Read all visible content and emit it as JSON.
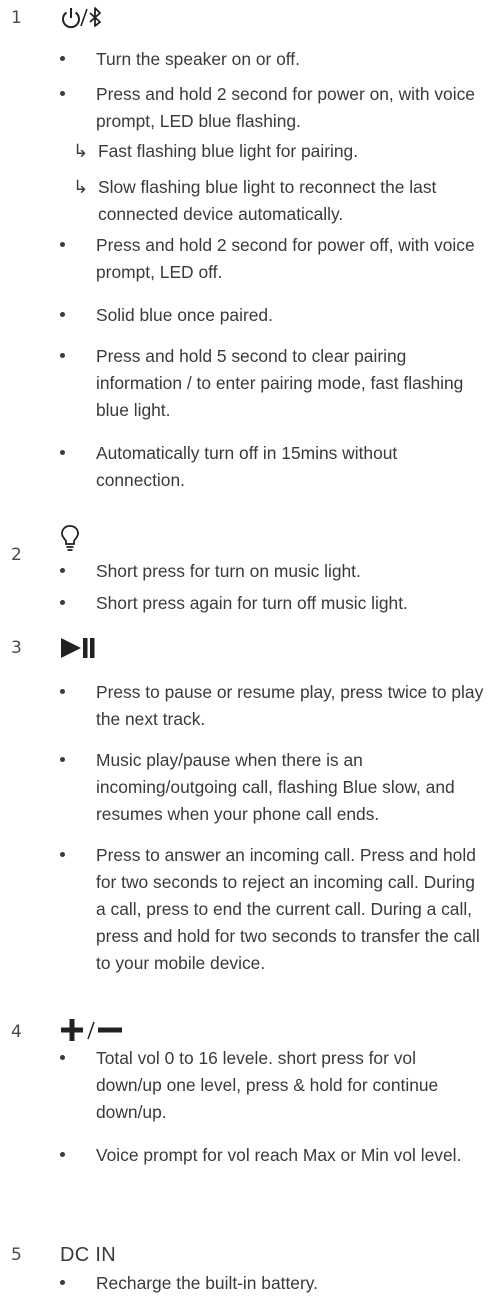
{
  "sections": [
    {
      "number": "1",
      "icon": "power-bluetooth-icon",
      "bullets": [
        "Turn the speaker on or off.",
        "Press and hold 2 second for power on, with voice prompt, LED blue flashing."
      ],
      "sub_items": [
        "Fast flashing blue light for pairing.",
        "Slow flashing blue light to reconnect the last connected device automatically."
      ],
      "bullets_after": [
        "Press and hold 2 second for power off, with voice prompt, LED off.",
        "Solid blue once paired.",
        "Press and hold 5 second to clear pairing information / to enter pairing mode, fast flashing blue light.",
        "Automatically turn off in 15mins without connection."
      ]
    },
    {
      "number": "2",
      "icon": "light-bulb-icon",
      "bullets": [
        "Short press for turn on music light.",
        "Short press again for turn off music light."
      ]
    },
    {
      "number": "3",
      "icon": "play-pause-icon",
      "bullets": [
        "Press to pause or resume play, press twice to play the next track.",
        "Music play/pause when there is an incoming/outgoing call, flashing Blue slow, and resumes when your phone call ends.",
        "Press to answer an incoming call. Press and hold for two seconds to reject an incoming call. During a call, press to end the current call. During a call, press and hold for two seconds to transfer the call to your mobile device."
      ]
    },
    {
      "number": "4",
      "icon": "volume-plus-minus-icon",
      "bullets": [
        "Total vol 0 to 16 levele. short press for vol down/up one level, press & hold for continue down/up.",
        "Voice prompt for vol reach Max or Min vol level."
      ]
    },
    {
      "number": "5",
      "heading": "DC IN",
      "bullets": [
        "Recharge the built-in battery."
      ]
    }
  ],
  "arrow_glyph": "↳"
}
